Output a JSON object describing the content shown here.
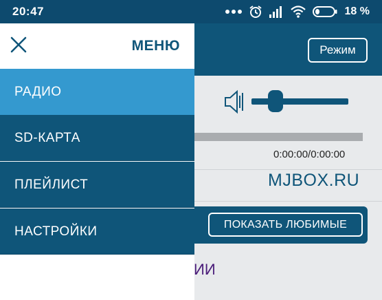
{
  "status_bar": {
    "time": "20:47",
    "battery": "18 %",
    "icons": [
      "more-dots-icon",
      "alarm-icon",
      "signal-icon",
      "wifi-icon",
      "battery-icon"
    ]
  },
  "background_app": {
    "mode_button_label": "Режим",
    "playback_time": "0:00:00/0:00:00",
    "site_text": "MJBOX.RU",
    "favorites_button_label": "ПОКАЗАТЬ ЛЮБИМЫЕ",
    "partial_text": "ИИ",
    "volume_level": 0.2
  },
  "drawer": {
    "title": "МЕНЮ",
    "items": [
      {
        "label": "РАДИО",
        "active": true
      },
      {
        "label": "SD-КАРТА",
        "active": false
      },
      {
        "label": "ПЛЕЙЛИСТ",
        "active": false
      },
      {
        "label": "НАСТРОЙКИ",
        "active": false
      }
    ]
  },
  "colors": {
    "primary": "#0f5579",
    "accent": "#3499cf",
    "status_bar": "#0d4a6e"
  }
}
